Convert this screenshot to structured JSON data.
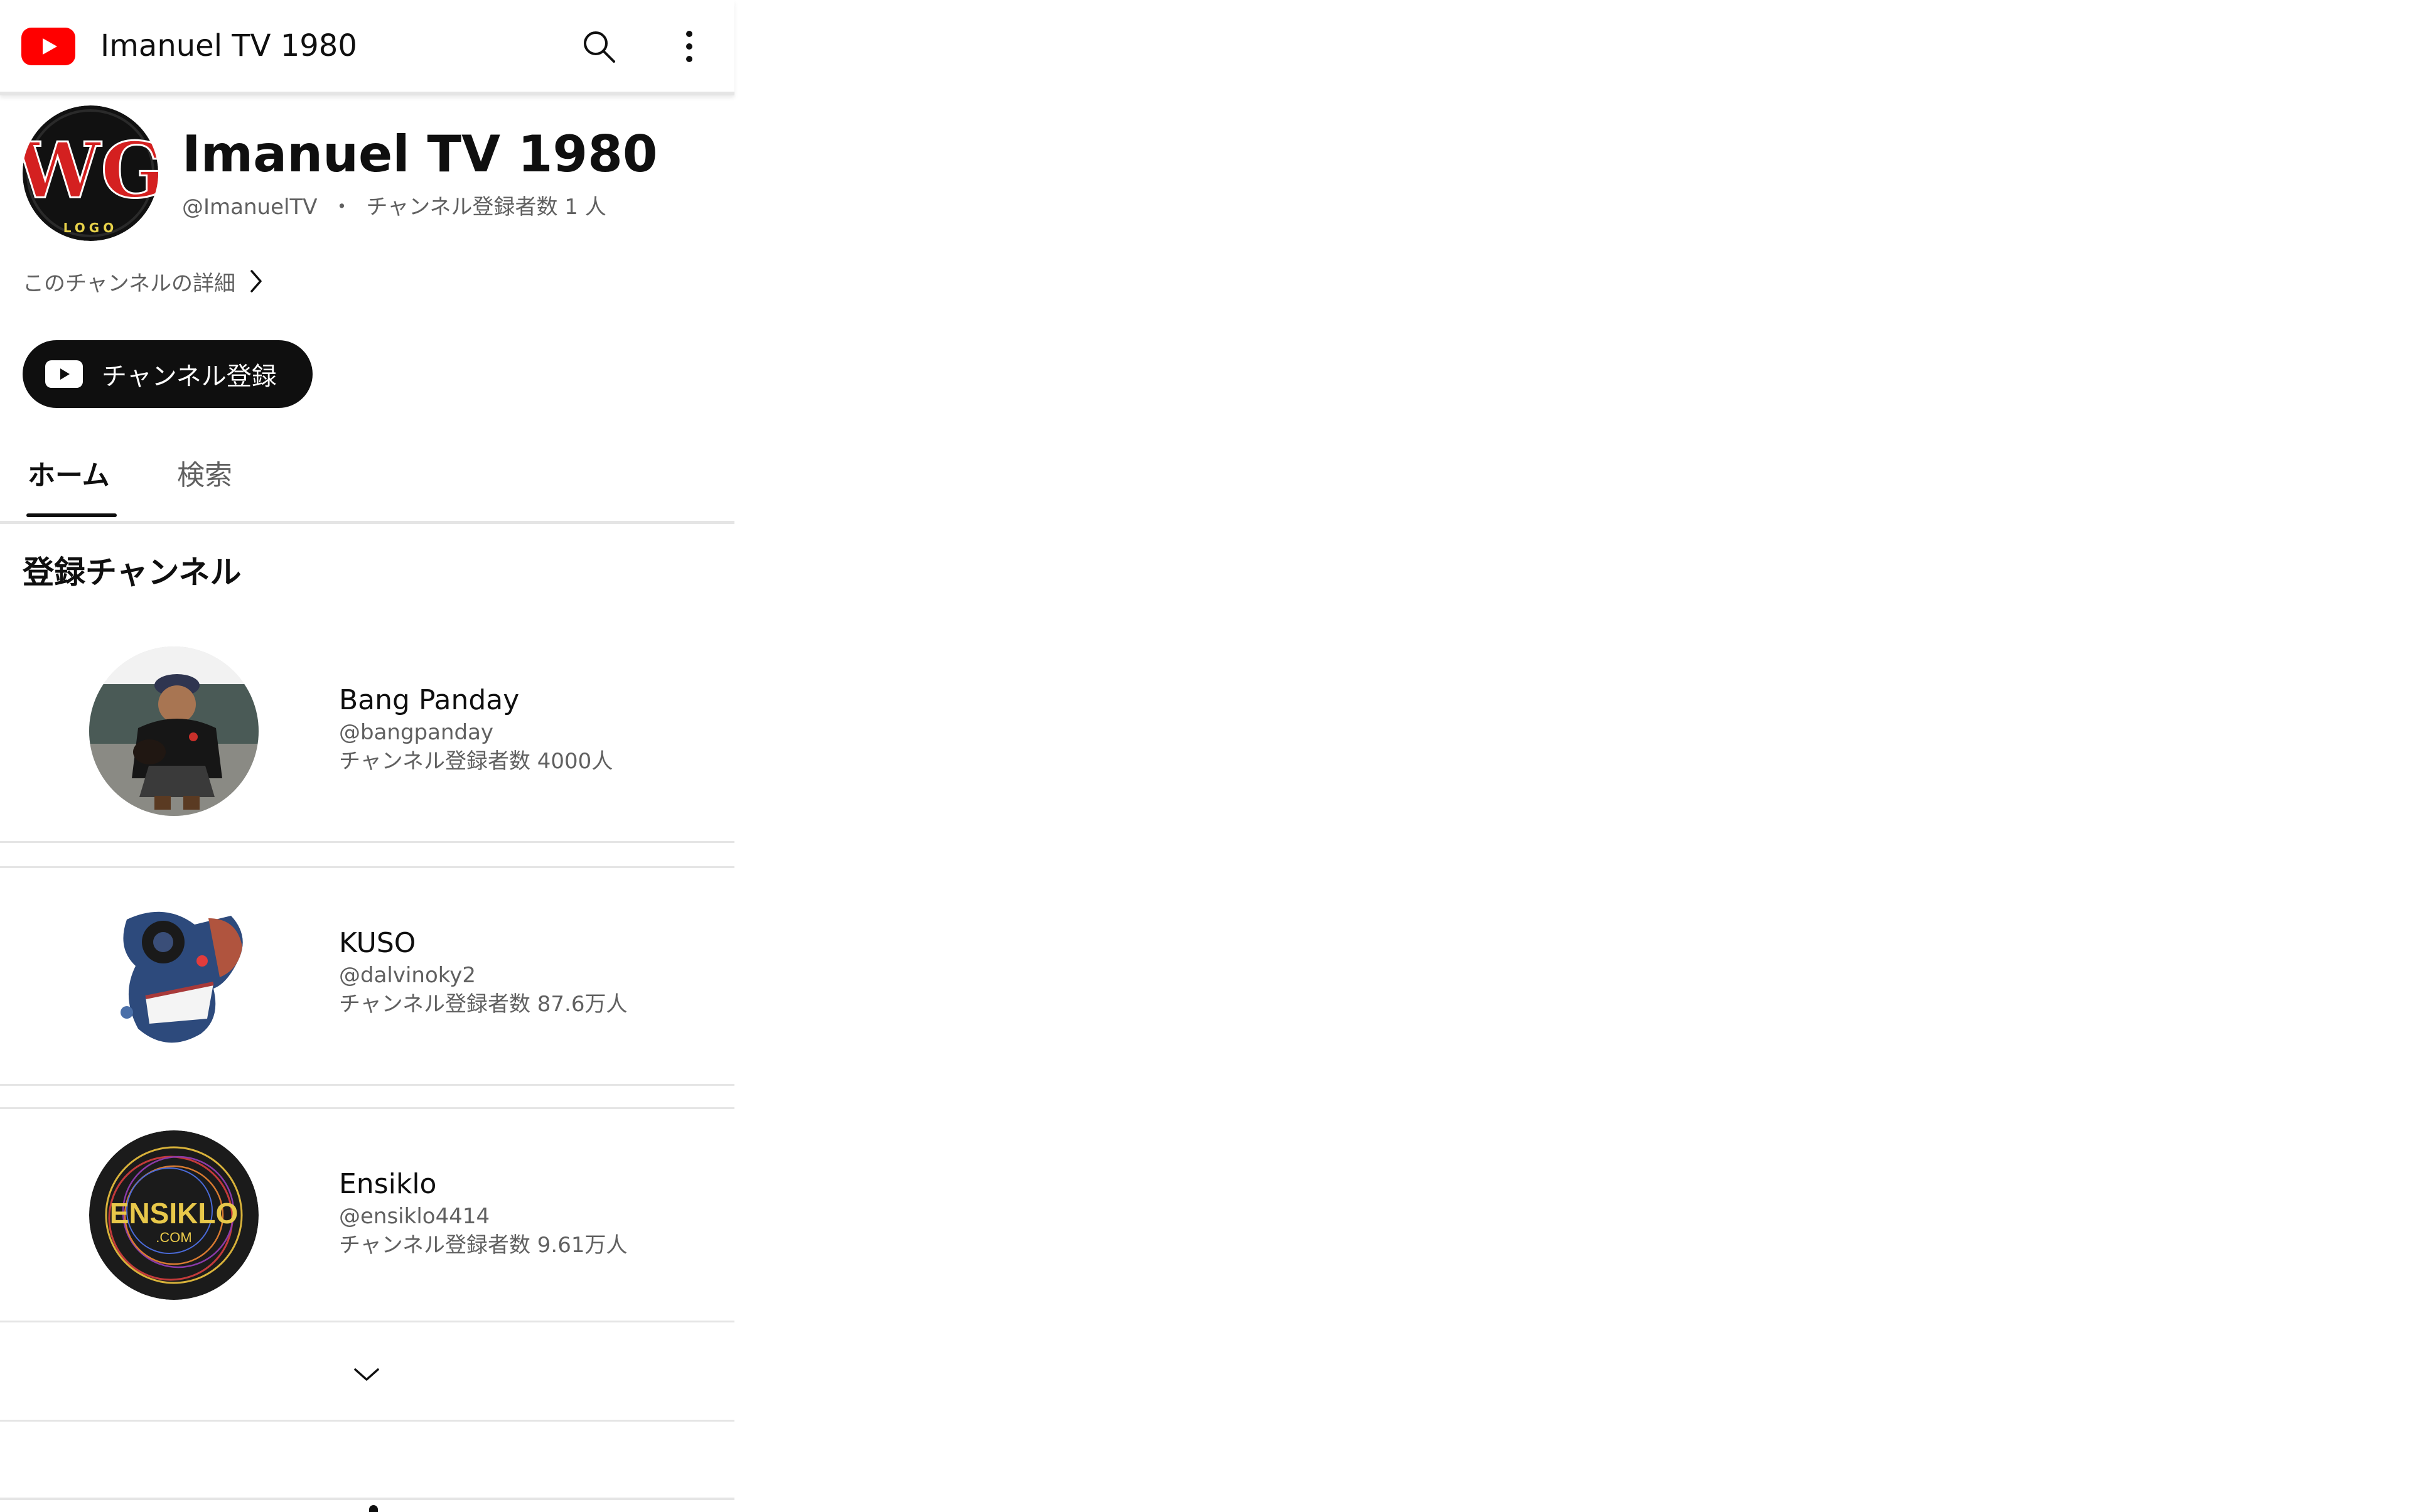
{
  "topbar": {
    "title": "Imanuel TV 1980",
    "logo_icon": "youtube-logo-icon",
    "search_icon": "search-icon",
    "more_icon": "more-vert-icon",
    "brand_color": "#ff0000"
  },
  "channel": {
    "name": "Imanuel TV 1980",
    "handle": "@ImanuelTV",
    "separator": "・",
    "subscribers": "チャンネル登録者数 1 人",
    "avatar_text": "WG",
    "avatar_subtext": "LOGO",
    "details_link": "このチャンネルの詳細",
    "subscribe_label": "チャンネル登録"
  },
  "tabs": [
    {
      "label": "ホーム",
      "selected": true
    },
    {
      "label": "検索",
      "selected": false
    }
  ],
  "subscriptions": {
    "title": "登録チャンネル",
    "items": [
      {
        "name": "Bang Panday",
        "handle": "@bangpanday",
        "subscribers": "チャンネル登録者数 4000人",
        "avatar": "person-photo"
      },
      {
        "name": "KUSO",
        "handle": "@dalvinoky2",
        "subscribers": "チャンネル登録者数 87.6万人",
        "avatar": "creature-illustration"
      },
      {
        "name": "Ensiklo",
        "handle": "@ensiklo4414",
        "subscribers": "チャンネル登録者数 9.61万人",
        "avatar": "ensiklo-logo"
      }
    ],
    "expand_icon": "chevron-down-icon",
    "ensiklo_logo_text": "ENSIKLO",
    "ensiklo_logo_subtext": ".COM"
  }
}
